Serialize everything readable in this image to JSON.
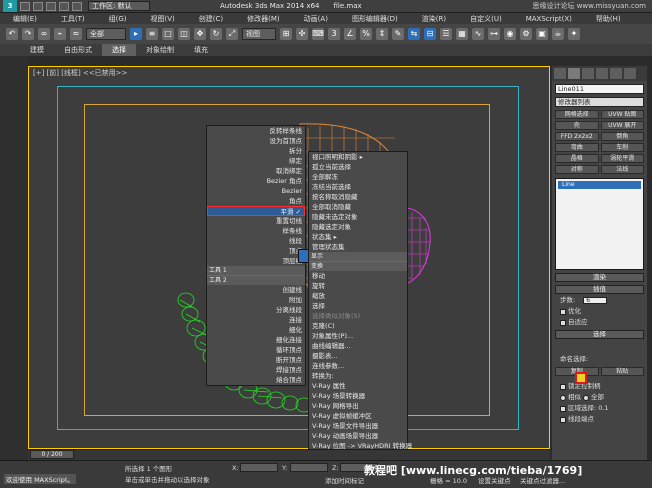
{
  "titlebar": {
    "workspace": "工作区: 默认",
    "title": "Autodesk 3ds Max  2014 x64",
    "file": "file.max",
    "watermark": "思缘设计论坛 www.missyuan.com"
  },
  "menubar": [
    "编辑(E)",
    "工具(T)",
    "组(G)",
    "视图(V)",
    "创建(C)",
    "修改器(M)",
    "动画(A)",
    "图形编辑器(D)",
    "渲染(R)",
    "自定义(U)",
    "MAXScript(X)",
    "帮助(H)"
  ],
  "toolbar": {
    "selection_filter": "全部",
    "ref_coord": "视图"
  },
  "ribbon": {
    "tabs": [
      "建模",
      "自由形式",
      "选择",
      "对象绘制",
      "填充"
    ],
    "active": "选择"
  },
  "viewport": {
    "label": "[+] [前] [线框] <<已禁用>>"
  },
  "quad_menu": {
    "left": {
      "top_items": [
        "反转样条线",
        "设为首顶点",
        "拆分",
        "绑定",
        "取消绑定",
        "Bezier 角点",
        "Bezier",
        "角点",
        "平滑",
        "重置切线",
        "样条线",
        "线段",
        "顶点",
        "顶层级"
      ],
      "selected": "平滑",
      "top_header": "工具 1",
      "bottom_header": "工具 2",
      "bottom_items": [
        "创建线",
        "附加",
        "分离线段",
        "连接",
        "细化",
        "细化连接",
        "循环顶点",
        "断开顶点",
        "焊接顶点",
        "熔合顶点"
      ]
    },
    "right": {
      "top_items": [
        "视口照明和阴影 ▸",
        "孤立当前选择",
        "全部解冻",
        "冻结当前选择",
        "按名称取消隐藏",
        "全部取消隐藏",
        "隐藏未选定对象",
        "隐藏选定对象",
        "状态集 ▸",
        "管理状态集"
      ],
      "header_top": "显示",
      "header_bottom": "变换",
      "bottom_items": [
        "移动",
        "旋转",
        "缩放",
        "选择",
        "选择类似对象(S)",
        "克隆(C)",
        "对象属性(P)...",
        "曲线编辑器...",
        "摄影表...",
        "连线参数...",
        "转换为:",
        "V-Ray 属性",
        "V-Ray 场景转换器",
        "V-Ray 网格导出",
        "V-Ray 虚拟帧缓冲区",
        "V-Ray 场景文件导出器",
        "V-Ray 动画场景导出器",
        "V-Ray 位图 -> VRayHDRI 转换器"
      ]
    }
  },
  "command_panel": {
    "object_name": "Line011",
    "modifier_list": "修改器列表",
    "buttons": [
      "网格选择",
      "UVW 贴图",
      "壳",
      "UVW 展开",
      "FFD 2x2x2",
      "倒角",
      "弯曲",
      "车削",
      "晶格",
      "涡轮平滑",
      "对称",
      "法线"
    ],
    "stack_item": "Line",
    "rollouts": {
      "render": "渲染",
      "interp": "插值",
      "steps_label": "步数:",
      "steps_value": "6",
      "optimize": "优化",
      "adaptive": "自适应",
      "selection": "选择",
      "named_sel": "命名选择:",
      "copy": "复制",
      "paste": "粘贴",
      "lock_handles": "锁定控制柄",
      "similar": "相似",
      "all": "全部",
      "area_select": "区域选择:",
      "area_value": "0.1",
      "segment_end": "线段端点"
    }
  },
  "timeline": {
    "frame": "0 / 200"
  },
  "statusbar": {
    "status": "所选择 1 个图形",
    "prompt": "单击或单击并拖动以选择对象",
    "maxscript": "欢迎使用 MAXScript。",
    "add_key": "添加时间标记",
    "x_label": "X:",
    "y_label": "Y:",
    "z_label": "Z:",
    "grid": "栅格 = 10.0",
    "auto_key": "自动关键点",
    "set_key": "设置关键点",
    "key_filter": "关键点过滤器..."
  },
  "site_overlay": "教程吧 [www.linecg.com/tieba/1769]",
  "colors": {
    "frame_outer": "#31b5c2",
    "frame_inner": "#d8a437",
    "highlight": "#2d5b96",
    "shape_green": "#22dd22",
    "shape_orange": "#e0883a",
    "shape_magenta": "#e03ae0"
  }
}
